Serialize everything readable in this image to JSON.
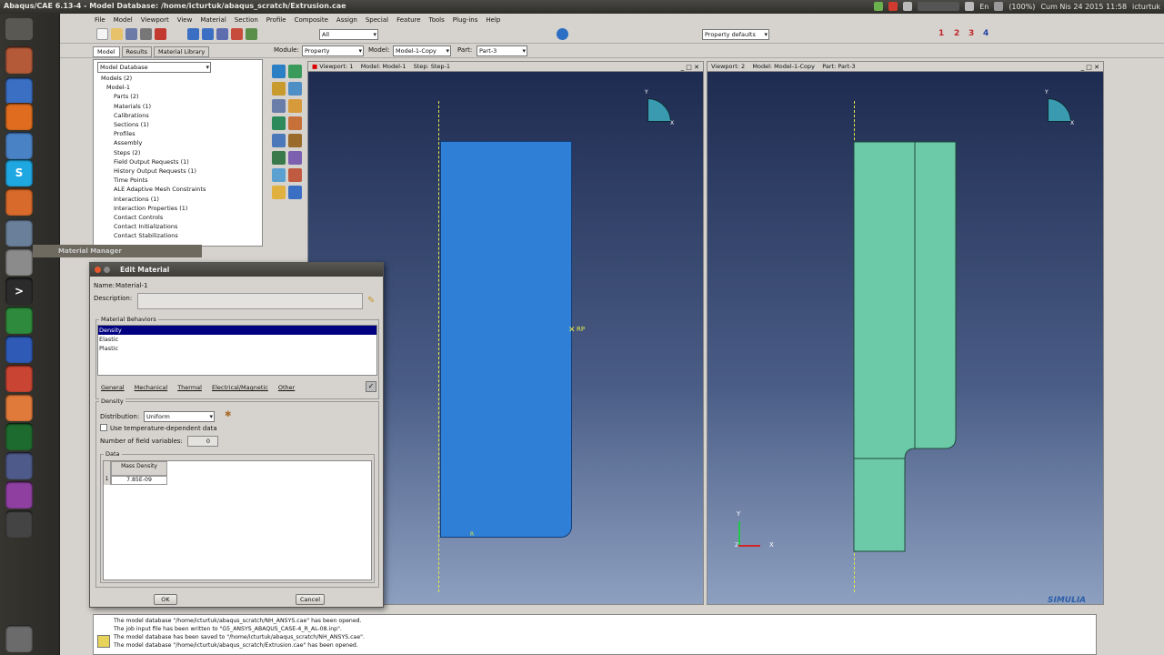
{
  "window_title": "Abaqus/CAE 6.13-4 - Model Database: /home/icturtuk/abaqus_scratch/Extrusion.cae",
  "system_tray": {
    "battery": "(100%)",
    "datetime": "Cum Nis 24 2015 11:58",
    "user": "icturtuk",
    "lang": "En"
  },
  "menu": [
    "File",
    "Model",
    "Viewport",
    "View",
    "Material",
    "Section",
    "Profile",
    "Composite",
    "Assign",
    "Special",
    "Feature",
    "Tools",
    "Plug-ins",
    "Help"
  ],
  "toolbar": {
    "selection_filter": "All",
    "render_style": "Property defaults",
    "numbers": [
      "1",
      "2",
      "3",
      "4"
    ]
  },
  "context_bar": {
    "module_label": "Module:",
    "module": "Property",
    "model_label": "Model:",
    "model": "Model-1-Copy",
    "part_label": "Part:",
    "part": "Part-3"
  },
  "tree": {
    "tabs": [
      "Model",
      "Results",
      "Material Library"
    ],
    "database": "Model Database",
    "items": [
      "Models (2)",
      "Model-1",
      "Parts (2)",
      "Materials (1)",
      "Calibrations",
      "Sections (1)",
      "Profiles",
      "Assembly",
      "Steps (2)",
      "Field Output Requests (1)",
      "History Output Requests (1)",
      "Time Points",
      "ALE Adaptive Mesh Constraints",
      "Interactions (1)",
      "Interaction Properties (1)",
      "Contact Controls",
      "Contact Initializations",
      "Contact Stabilizations"
    ]
  },
  "viewport1": {
    "title": "Viewport: 1",
    "model": "Model: Model-1",
    "step": "Step: Step-1",
    "rp_label": "RP",
    "r_label": "R"
  },
  "viewport2": {
    "title": "Viewport: 2",
    "model": "Model: Model-1-Copy",
    "part": "Part: Part-3"
  },
  "axis": {
    "x": "X",
    "y": "Y",
    "z": "Z"
  },
  "material_manager": {
    "title": "Material Manager"
  },
  "edit_material": {
    "title": "Edit Material",
    "name_label": "Name:",
    "name": "Material-1",
    "description_label": "Description:",
    "behaviors_label": "Material Behaviors",
    "behaviors": [
      "Density",
      "Elastic",
      "Plastic"
    ],
    "menus": [
      "General",
      "Mechanical",
      "Thermal",
      "Electrical/Magnetic",
      "Other"
    ],
    "section_label": "Density",
    "distribution_label": "Distribution:",
    "distribution": "Uniform",
    "temp_dependent_label": "Use temperature-dependent data",
    "field_vars_label": "Number of field variables:",
    "field_vars": "0",
    "data_label": "Data",
    "col_header": "Mass Density",
    "row_num": "1",
    "cell_value": "7.85E-09",
    "ok": "OK",
    "cancel": "Cancel"
  },
  "messages": [
    "The model database \"/home/icturtuk/abaqus_scratch/NH_ANSYS.cae\" has been opened.",
    "The job input file has been written to \"G5_ANSYS_ABAQUS_CASE-4_R_AL-08.inp\".",
    "The model database has been saved to \"/home/icturtuk/abaqus_scratch/NH_ANSYS.cae\".",
    "The model database \"/home/icturtuk/abaqus_scratch/Extrusion.cae\" has been opened."
  ],
  "brand": "SIMULIA",
  "colors": {
    "part1": "#2f7fd6",
    "part2": "#6ccaa9",
    "selection": "#000080",
    "bg_top": "#1d2a4f"
  }
}
